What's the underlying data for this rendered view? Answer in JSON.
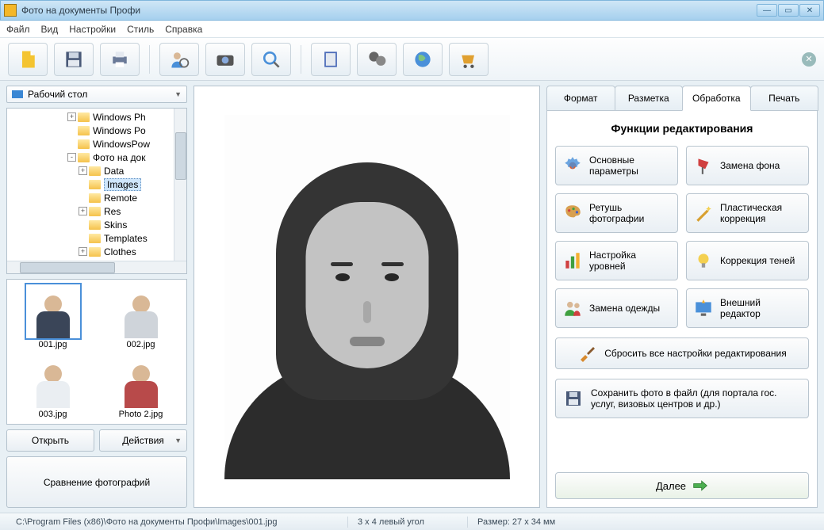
{
  "title": "Фото на документы Профи",
  "menu": [
    "Файл",
    "Вид",
    "Настройки",
    "Стиль",
    "Справка"
  ],
  "toolbar_icons": [
    "new-file",
    "save",
    "print",
    "person-zoom",
    "camera",
    "magnifier",
    "book",
    "film",
    "globe",
    "cart"
  ],
  "combo": {
    "label": "Рабочий стол"
  },
  "tree": [
    {
      "indent": 5,
      "exp": "+",
      "label": "Windows Ph"
    },
    {
      "indent": 5,
      "exp": "",
      "label": "Windows Po"
    },
    {
      "indent": 5,
      "exp": "",
      "label": "WindowsPow"
    },
    {
      "indent": 5,
      "exp": "-",
      "label": "Фото на док"
    },
    {
      "indent": 6,
      "exp": "+",
      "label": "Data"
    },
    {
      "indent": 6,
      "exp": "",
      "label": "Images",
      "sel": true
    },
    {
      "indent": 6,
      "exp": "",
      "label": "Remote"
    },
    {
      "indent": 6,
      "exp": "+",
      "label": "Res"
    },
    {
      "indent": 6,
      "exp": "",
      "label": "Skins"
    },
    {
      "indent": 6,
      "exp": "",
      "label": "Templates"
    },
    {
      "indent": 6,
      "exp": "+",
      "label": "Clothes"
    }
  ],
  "thumbs": [
    {
      "name": "001.jpg",
      "sel": true,
      "cls": "c1"
    },
    {
      "name": "002.jpg",
      "sel": false,
      "cls": "c2"
    },
    {
      "name": "003.jpg",
      "sel": false,
      "cls": "c3"
    },
    {
      "name": "Photo 2.jpg",
      "sel": false,
      "cls": "c4"
    }
  ],
  "buttons": {
    "open": "Открыть",
    "actions": "Действия",
    "compare": "Сравнение фотографий"
  },
  "tabs": [
    "Формат",
    "Разметка",
    "Обработка",
    "Печать"
  ],
  "active_tab": 2,
  "panel_title": "Функции редактирования",
  "edit_funcs": [
    {
      "icon": "gear",
      "label": "Основные параметры"
    },
    {
      "icon": "lamp",
      "label": "Замена фона"
    },
    {
      "icon": "palette",
      "label": "Ретушь фотографии"
    },
    {
      "icon": "wand",
      "label": "Пластическая коррекция"
    },
    {
      "icon": "bars",
      "label": "Настройка уровней"
    },
    {
      "icon": "bulb",
      "label": "Коррекция теней"
    },
    {
      "icon": "people",
      "label": "Замена одежды"
    },
    {
      "icon": "monitor",
      "label": "Внешний редактор"
    }
  ],
  "reset_label": "Сбросить все настройки редактирования",
  "save_label": "Сохранить фото в файл (для портала гос. услуг, визовых центров и др.)",
  "next_label": "Далее",
  "status": {
    "path": "C:\\Program Files (x86)\\Фото на документы Профи\\Images\\001.jpg",
    "grid": "3 x 4 левый угол",
    "size": "Размер: 27 x 34 мм"
  }
}
